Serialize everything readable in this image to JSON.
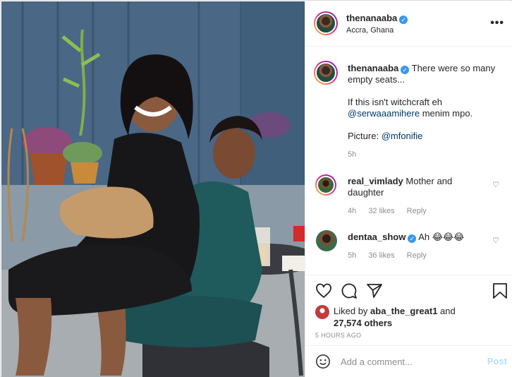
{
  "post": {
    "username": "thenanaaba",
    "location": "Accra, Ghana",
    "more_icon": "more-horizontal-icon",
    "caption": {
      "username": "thenanaaba",
      "line1": "There were so many empty seats...",
      "line2a": "If this isn't witchcraft eh",
      "mention": "@serwaaamihere",
      "line2b": " menim mpo.",
      "picture_label": "Picture: ",
      "picture_mention": "@mfonifie",
      "time": "5h"
    },
    "comments": [
      {
        "username": "real_vimlady",
        "verified": false,
        "text": "Mother and daughter",
        "time": "4h",
        "likes": "32 likes",
        "reply": "Reply"
      },
      {
        "username": "dentaa_show",
        "verified": true,
        "text": "Ah 😂😂😂",
        "time": "5h",
        "likes": "36 likes",
        "reply": "Reply"
      }
    ],
    "liked_by_prefix": "Liked by ",
    "liked_by_user": "aba_the_great1",
    "liked_by_and": " and",
    "liked_by_count": "27,574 others",
    "time_ago": "5 HOURS AGO",
    "add_comment_placeholder": "Add a comment...",
    "post_label": "Post"
  },
  "colors": {
    "accent": "#0095f6",
    "verified": "#3897f0",
    "post_disabled": "#b2dffc"
  }
}
